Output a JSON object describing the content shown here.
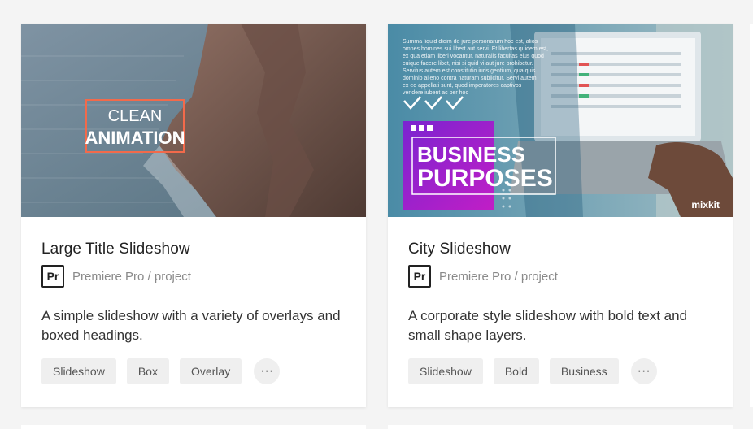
{
  "cards": [
    {
      "title": "Large Title Slideshow",
      "app_badge": "Pr",
      "app_label": "Premiere Pro / project",
      "description": "A simple slideshow with a variety of overlays and boxed headings.",
      "tags": [
        "Slideshow",
        "Box",
        "Overlay"
      ],
      "more": "···",
      "thumb_text": [
        "CLEAN",
        "ANIMATION"
      ]
    },
    {
      "title": "City Slideshow",
      "app_badge": "Pr",
      "app_label": "Premiere Pro / project",
      "description": "A corporate style slideshow with bold text and small shape layers.",
      "tags": [
        "Slideshow",
        "Bold",
        "Business"
      ],
      "more": "···",
      "thumb_text": [
        "BUSINESS",
        "PURPOSES"
      ],
      "thumb_brand": "mixkit",
      "thumb_small_text": "Summa liquid dicim de jure personarum hoc est, alios omnes homines sui libert aut servi. Et libertas quidem est, ex qua etiam liberi vocantur, naturalis facultas eius quod cuique facere libet, nisi si quid vi aut jure prohibetur. Servitus autem est constitutio iuris gentium, qua quis dominio alieno contra naturam subjicitur. Servi autem ex eo appellati sunt, quod imperatores captivos vendere iubent ac per hoc"
    }
  ]
}
